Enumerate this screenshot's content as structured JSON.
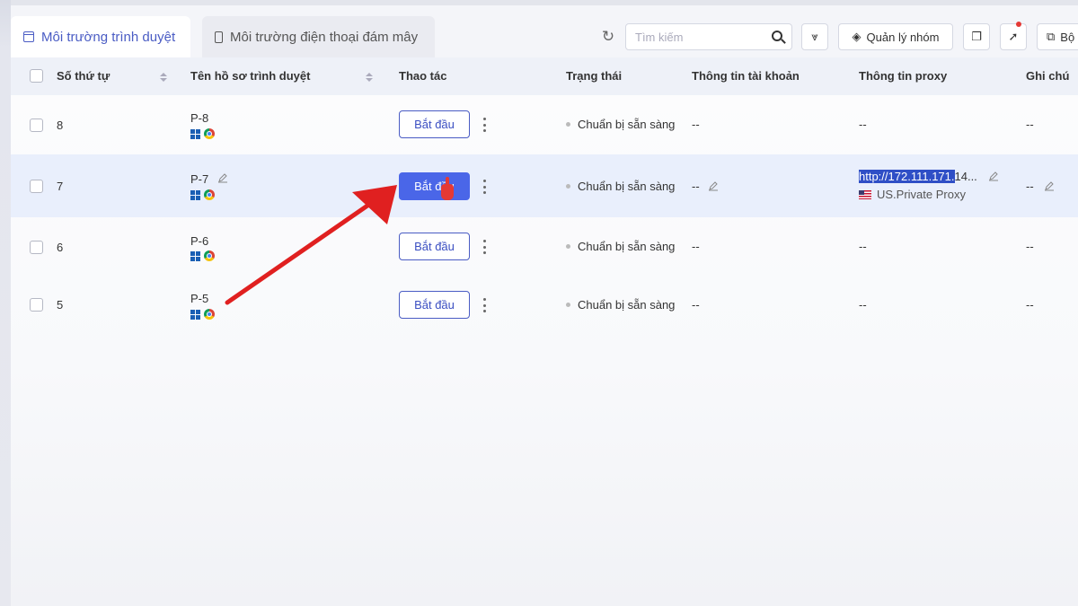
{
  "tabs": [
    {
      "label": "Môi trường trình duyệt",
      "icon": "browser-icon"
    },
    {
      "label": "Môi trường điện thoại đám mây",
      "icon": "phone-icon"
    }
  ],
  "toolbar": {
    "search_placeholder": "Tìm kiếm",
    "group_manage_label": "Quản lý nhóm",
    "partial_label": "Bộ"
  },
  "table": {
    "headers": [
      "Số thứ tự",
      "Tên hồ sơ trình duyệt",
      "Thao tác",
      "Trạng thái",
      "Thông tin tài khoản",
      "Thông tin proxy",
      "Ghi chú"
    ],
    "rows": [
      {
        "index": "8",
        "name": "P-8",
        "action": "Bắt đầu",
        "status": "Chuẩn bị sẵn sàng",
        "account": "--",
        "proxy": "--",
        "note": "--"
      },
      {
        "index": "7",
        "name": "P-7",
        "action": "Bắt đầu",
        "status": "Chuẩn bị sẵn sàng",
        "account": "--",
        "proxy_url_selected": "http://172.111.171.",
        "proxy_url_rest": "14...",
        "proxy_label": "US.Private Proxy",
        "note": "--"
      },
      {
        "index": "6",
        "name": "P-6",
        "action": "Bắt đầu",
        "status": "Chuẩn bị sẵn sàng",
        "account": "--",
        "proxy": "--",
        "note": "--"
      },
      {
        "index": "5",
        "name": "P-5",
        "action": "Bắt đầu",
        "status": "Chuẩn bị sẵn sàng",
        "account": "--",
        "proxy": "--",
        "note": "--"
      }
    ]
  },
  "colors": {
    "accent": "#4a66e8",
    "annotation_arrow": "#e02020"
  }
}
